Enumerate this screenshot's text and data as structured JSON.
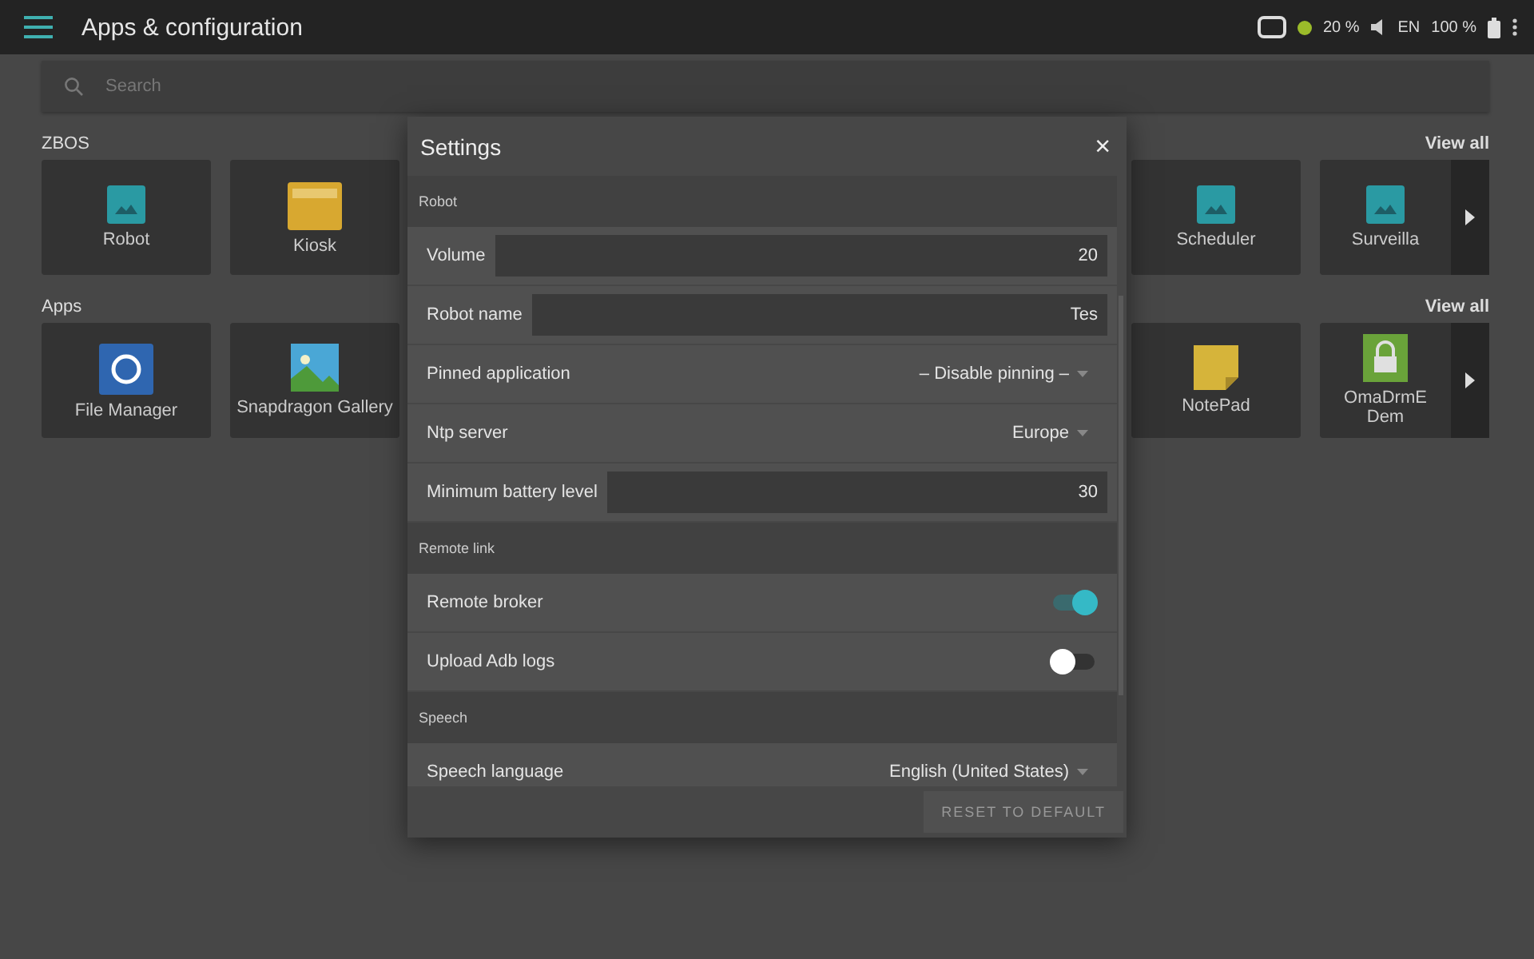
{
  "app_bar": {
    "title": "Apps & configuration",
    "status": {
      "connected": true,
      "volume": "20 %",
      "language": "EN",
      "battery": "100 %"
    }
  },
  "search": {
    "placeholder": "Search"
  },
  "sections": [
    {
      "title": "ZBOS",
      "view_all": "View all",
      "left_tiles": [
        {
          "label": "Robot",
          "kind": "image"
        },
        {
          "label": "Kiosk",
          "kind": "folder"
        }
      ],
      "right_tiles": [
        {
          "label": "Scheduler",
          "kind": "image"
        },
        {
          "label": "Surveilla",
          "kind": "image"
        }
      ]
    },
    {
      "title": "Apps",
      "view_all": "View all",
      "left_tiles": [
        {
          "label": "File Manager",
          "kind": "files"
        },
        {
          "label": "Snapdragon Gallery",
          "kind": "gallery"
        }
      ],
      "right_tiles": [
        {
          "label": "NotePad",
          "kind": "note"
        },
        {
          "label": "OmaDrmE Dem",
          "kind": "lock"
        }
      ]
    }
  ],
  "dialog": {
    "title": "Settings",
    "close": "×",
    "reset": "RESET TO DEFAULT",
    "groups": [
      {
        "title": "Robot",
        "rows": [
          {
            "kind": "input",
            "label": "Volume",
            "value": "20"
          },
          {
            "kind": "input",
            "label": "Robot name",
            "value": "Tes"
          },
          {
            "kind": "select",
            "label": "Pinned application",
            "value": "– Disable pinning –"
          },
          {
            "kind": "select",
            "label": "Ntp server",
            "value": "Europe"
          },
          {
            "kind": "input",
            "label": "Minimum battery level",
            "value": "30"
          }
        ]
      },
      {
        "title": "Remote link",
        "rows": [
          {
            "kind": "switch",
            "label": "Remote broker",
            "on": true
          },
          {
            "kind": "switch",
            "label": "Upload Adb logs",
            "on": false
          }
        ]
      },
      {
        "title": "Speech",
        "rows": [
          {
            "kind": "select",
            "label": "Speech language",
            "value": "English (United States)"
          }
        ]
      }
    ]
  }
}
